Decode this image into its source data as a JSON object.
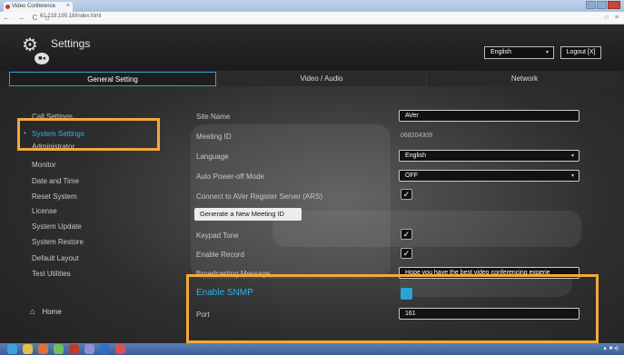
{
  "browser": {
    "tab_title": "Video Conference",
    "tab_close": "×",
    "url": "61.219.195.18/index.html",
    "nav_icons": "← → C ⌂",
    "bookmarks": "☆ ≡"
  },
  "header": {
    "title": "Settings",
    "language": "English",
    "logout_label": "Logout [X]"
  },
  "tabs": [
    {
      "label": "General Setting",
      "active": true
    },
    {
      "label": "Video / Audio",
      "active": false
    },
    {
      "label": "Network",
      "active": false
    }
  ],
  "sidebar": {
    "items": [
      {
        "label": "Call Settings"
      },
      {
        "label": "System Settings",
        "selected": true
      },
      {
        "label": "Administrator"
      },
      {
        "label": "Monitor"
      },
      {
        "label": "Date and Time"
      },
      {
        "label": "Reset System"
      },
      {
        "label": "License"
      },
      {
        "label": "System Update"
      },
      {
        "label": "System Restore"
      },
      {
        "label": "Default Layout"
      },
      {
        "label": "Test Utilities"
      }
    ],
    "home_label": "Home"
  },
  "settings": {
    "site_name_label": "Site Name",
    "site_name_value": "AVer",
    "meeting_id_label": "Meeting ID",
    "meeting_id_value": "068204309",
    "language_label": "Language",
    "language_value": "English",
    "auto_power_off_label": "Auto Power-off Mode",
    "auto_power_off_value": "OFF",
    "ars_label": "Connect to AVer Register Server (ARS)",
    "ars_checked": true,
    "generate_button_label": "Generate a New Meeting ID",
    "keypad_tone_label": "Keypad Tone",
    "keypad_tone_checked": true,
    "enable_record_label": "Enable Record",
    "enable_record_checked": true,
    "broadcasting_label": "Broadcasting Message",
    "broadcasting_value": "Hope you have the best video conferencing experie",
    "enable_snmp_label": "Enable SNMP",
    "port_label": "Port",
    "port_value": "161"
  },
  "colors": {
    "accent": "#2aa4d6",
    "highlight": "#f2a93b"
  }
}
